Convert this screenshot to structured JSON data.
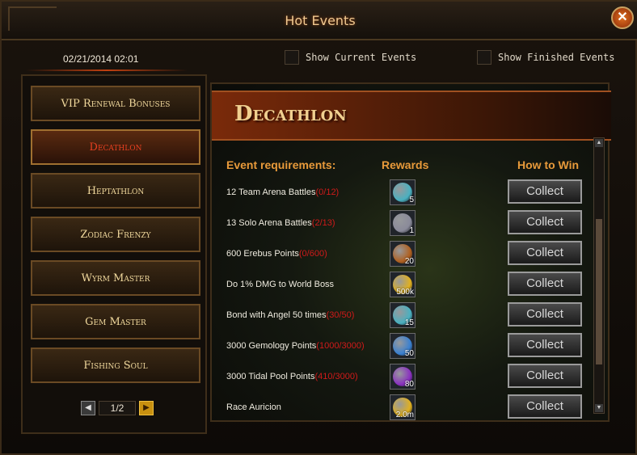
{
  "window": {
    "title": "Hot Events",
    "close_label": "✕"
  },
  "filters": {
    "datetime": "02/21/2014 02:01",
    "show_current": "Show Current Events",
    "show_finished": "Show Finished Events"
  },
  "events": [
    {
      "label": "VIP Renewal Bonuses",
      "active": false
    },
    {
      "label": "Decathlon",
      "active": true
    },
    {
      "label": "Heptathlon",
      "active": false
    },
    {
      "label": "Zodiac Frenzy",
      "active": false
    },
    {
      "label": "Wyrm Master",
      "active": false
    },
    {
      "label": "Gem Master",
      "active": false
    },
    {
      "label": "Fishing Soul",
      "active": false
    }
  ],
  "pager": {
    "page": "1/2",
    "prev": "◀",
    "next": "▶"
  },
  "detail": {
    "banner": "Decathlon",
    "headers": {
      "requirements": "Event requirements:",
      "rewards": "Rewards",
      "how_to_win": "How to Win"
    },
    "rows": [
      {
        "req": "12 Team Arena Battles",
        "progress": "(0/12)",
        "qty": "5",
        "icon": "potion-icon",
        "color": "#4ab0c0",
        "button": "Collect"
      },
      {
        "req": "13 Solo Arena Battles",
        "progress": "(2/13)",
        "qty": "1",
        "icon": "chest-icon",
        "color": "#8a8a9a",
        "button": "Collect"
      },
      {
        "req": "600 Erebus Points",
        "progress": "(0/600)",
        "qty": "20",
        "icon": "coin-icon",
        "color": "#b06020",
        "button": "Collect"
      },
      {
        "req": "Do 1% DMG to World Boss",
        "progress": "",
        "qty": "500k",
        "icon": "gold-coin-icon",
        "color": "#e0b020",
        "button": "Collect"
      },
      {
        "req": "Bond with Angel 50 times",
        "progress": "(30/50)",
        "qty": "15",
        "icon": "potion-icon",
        "color": "#4ab0c0",
        "button": "Collect"
      },
      {
        "req": "3000 Gemology Points",
        "progress": "(1000/3000)",
        "qty": "50",
        "icon": "gem-icon",
        "color": "#3a80d0",
        "button": "Collect"
      },
      {
        "req": "3000 Tidal Pool Points",
        "progress": "(410/3000)",
        "qty": "80",
        "icon": "orb-icon",
        "color": "#8a30c0",
        "button": "Collect"
      },
      {
        "req": "Race Auricion",
        "progress": "",
        "qty": "2.0m",
        "icon": "gold-coin-icon",
        "color": "#e0b020",
        "button": "Collect"
      }
    ],
    "scroll_up": "▲",
    "scroll_down": "▼"
  }
}
